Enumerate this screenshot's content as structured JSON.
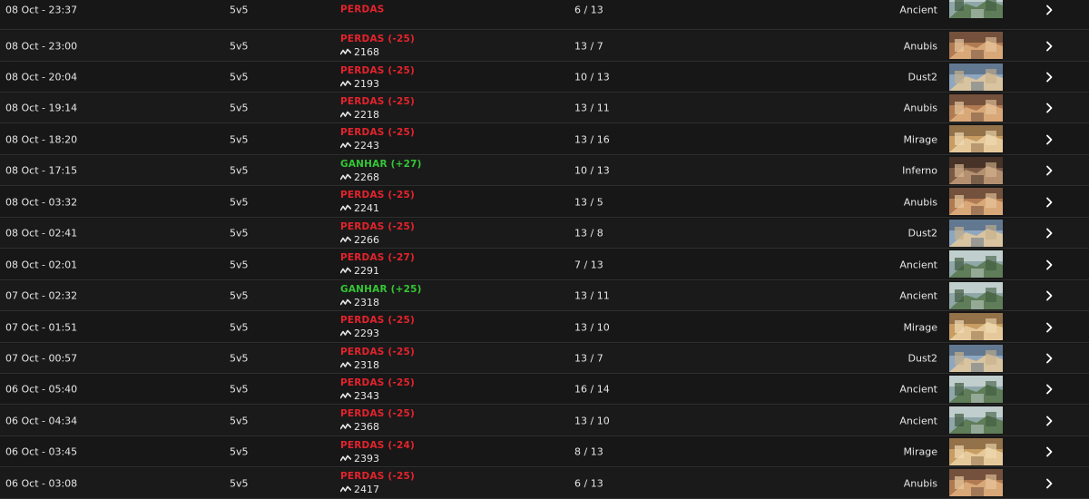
{
  "colors": {
    "loss": "#e3232c",
    "win": "#34c634",
    "background": "#161616"
  },
  "icons": {
    "elo": "elo-trend-icon",
    "open": "chevron-right-icon"
  },
  "matches": [
    {
      "date": "08 Oct - 23:37",
      "mode": "5v5",
      "outcome": "loss",
      "result": "PERDAS",
      "elo": "",
      "score": "6 / 13",
      "map": "Ancient"
    },
    {
      "date": "08 Oct - 23:00",
      "mode": "5v5",
      "outcome": "loss",
      "result": "PERDAS (-25)",
      "elo": "2168",
      "score": "13 / 7",
      "map": "Anubis"
    },
    {
      "date": "08 Oct - 20:04",
      "mode": "5v5",
      "outcome": "loss",
      "result": "PERDAS (-25)",
      "elo": "2193",
      "score": "10 / 13",
      "map": "Dust2"
    },
    {
      "date": "08 Oct - 19:14",
      "mode": "5v5",
      "outcome": "loss",
      "result": "PERDAS (-25)",
      "elo": "2218",
      "score": "13 / 11",
      "map": "Anubis"
    },
    {
      "date": "08 Oct - 18:20",
      "mode": "5v5",
      "outcome": "loss",
      "result": "PERDAS (-25)",
      "elo": "2243",
      "score": "13 / 16",
      "map": "Mirage"
    },
    {
      "date": "08 Oct - 17:15",
      "mode": "5v5",
      "outcome": "win",
      "result": "GANHAR (+27)",
      "elo": "2268",
      "score": "10 / 13",
      "map": "Inferno"
    },
    {
      "date": "08 Oct - 03:32",
      "mode": "5v5",
      "outcome": "loss",
      "result": "PERDAS (-25)",
      "elo": "2241",
      "score": "13 / 5",
      "map": "Anubis"
    },
    {
      "date": "08 Oct - 02:41",
      "mode": "5v5",
      "outcome": "loss",
      "result": "PERDAS (-25)",
      "elo": "2266",
      "score": "13 / 8",
      "map": "Dust2"
    },
    {
      "date": "08 Oct - 02:01",
      "mode": "5v5",
      "outcome": "loss",
      "result": "PERDAS (-27)",
      "elo": "2291",
      "score": "7 / 13",
      "map": "Ancient"
    },
    {
      "date": "07 Oct - 02:32",
      "mode": "5v5",
      "outcome": "win",
      "result": "GANHAR (+25)",
      "elo": "2318",
      "score": "13 / 11",
      "map": "Ancient"
    },
    {
      "date": "07 Oct - 01:51",
      "mode": "5v5",
      "outcome": "loss",
      "result": "PERDAS (-25)",
      "elo": "2293",
      "score": "13 / 10",
      "map": "Mirage"
    },
    {
      "date": "07 Oct - 00:57",
      "mode": "5v5",
      "outcome": "loss",
      "result": "PERDAS (-25)",
      "elo": "2318",
      "score": "13 / 7",
      "map": "Dust2"
    },
    {
      "date": "06 Oct - 05:40",
      "mode": "5v5",
      "outcome": "loss",
      "result": "PERDAS (-25)",
      "elo": "2343",
      "score": "16 / 14",
      "map": "Ancient"
    },
    {
      "date": "06 Oct - 04:34",
      "mode": "5v5",
      "outcome": "loss",
      "result": "PERDAS (-25)",
      "elo": "2368",
      "score": "13 / 10",
      "map": "Ancient"
    },
    {
      "date": "06 Oct - 03:45",
      "mode": "5v5",
      "outcome": "loss",
      "result": "PERDAS (-24)",
      "elo": "2393",
      "score": "8 / 13",
      "map": "Mirage"
    },
    {
      "date": "06 Oct - 03:08",
      "mode": "5v5",
      "outcome": "loss",
      "result": "PERDAS (-25)",
      "elo": "2417",
      "score": "6 / 13",
      "map": "Anubis"
    }
  ]
}
